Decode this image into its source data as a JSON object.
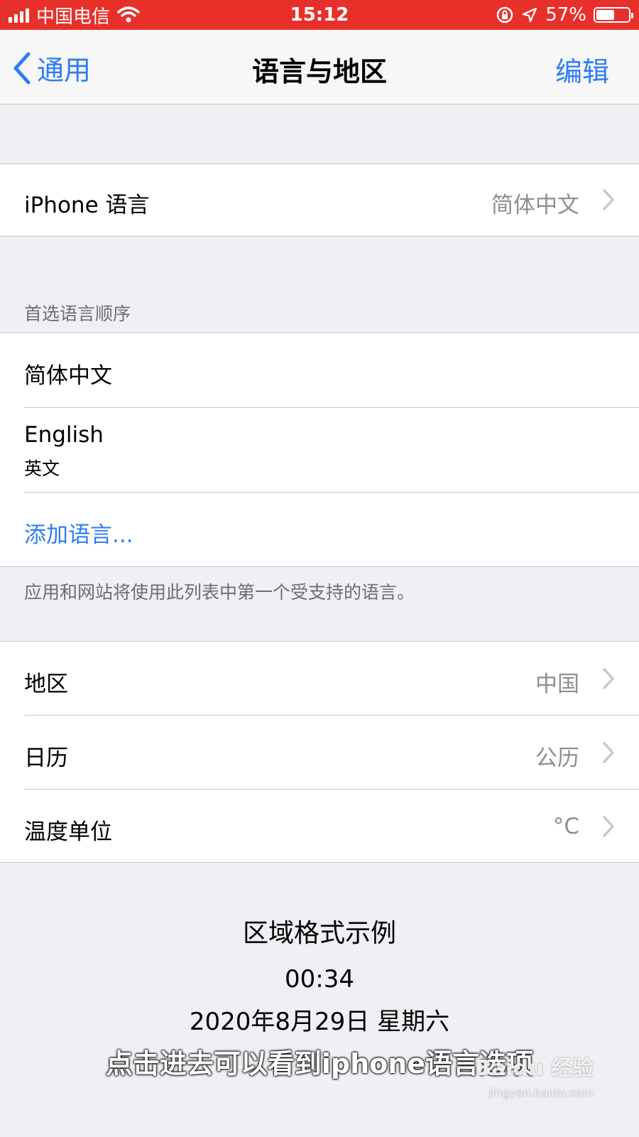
{
  "status_bar": {
    "carrier": "中国电信",
    "time": "15:12",
    "battery_percent": "57%",
    "battery_level": 0.57,
    "bg_color": "#e8302b"
  },
  "nav": {
    "back_label": "通用",
    "title": "语言与地区",
    "edit_label": "编辑",
    "accent_color": "#2e7cf6"
  },
  "iphone_language": {
    "label": "iPhone 语言",
    "value": "简体中文"
  },
  "preferred": {
    "header": "首选语言顺序",
    "languages": [
      {
        "name": "简体中文",
        "subtitle": ""
      },
      {
        "name": "English",
        "subtitle": "英文"
      }
    ],
    "add_label": "添加语言...",
    "footer": "应用和网站将使用此列表中第一个受支持的语言。"
  },
  "region_settings": [
    {
      "label": "地区",
      "value": "中国"
    },
    {
      "label": "日历",
      "value": "公历"
    },
    {
      "label": "温度单位",
      "value": "°C"
    }
  ],
  "format_example": {
    "title": "区域格式示例",
    "time": "00:34",
    "date": "2020年8月29日 星期六"
  },
  "watermark": {
    "caption": "点击进去可以看到iphone语言选项",
    "logo": "Baidu 经验",
    "url": "jingyan.baidu.com"
  }
}
